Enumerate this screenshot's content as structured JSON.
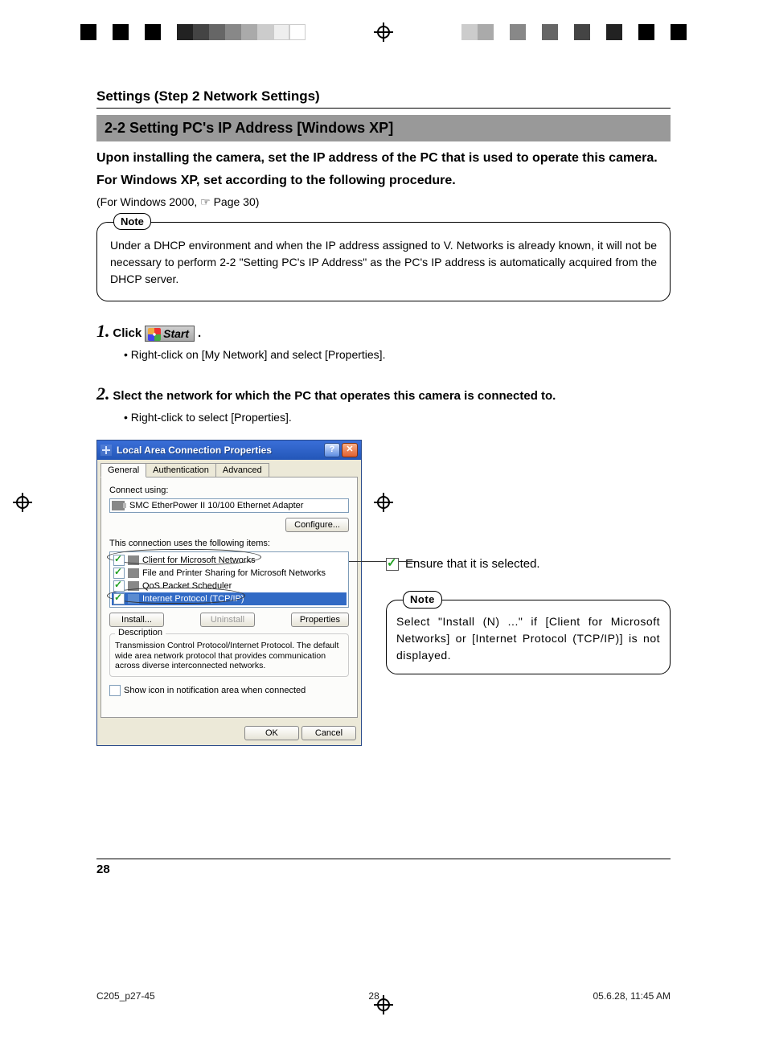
{
  "header": {
    "section_title": "Settings (Step 2 Network Settings)",
    "subsection_title": "2-2 Setting PC's IP Address [Windows XP]"
  },
  "intro": {
    "p1": "Upon installing the camera, set the IP address of the PC that is used to operate this camera.",
    "p2": "For Windows XP, set according to the following procedure.",
    "ref": "(For Windows 2000, ☞ Page 30)"
  },
  "note1": {
    "label": "Note",
    "text": "Under a DHCP environment and when the IP address assigned to V. Networks is already known, it will not be necessary to perform 2-2 \"Setting PC's IP Address\" as the PC's IP address is automatically acquired from the DHCP server."
  },
  "step1": {
    "num": "1.",
    "text_pre": "Click",
    "start_label": "Start",
    "text_post": ".",
    "bullet": "• Right-click on [My Network] and select [Properties]."
  },
  "step2": {
    "num": "2.",
    "text": "Slect the network for which the PC that operates this camera is connected to.",
    "bullet": "• Right-click to select [Properties]."
  },
  "dialog": {
    "title": "Local Area Connection Properties",
    "help": "?",
    "close": "✕",
    "tabs": {
      "general": "General",
      "auth": "Authentication",
      "adv": "Advanced"
    },
    "connect_using_label": "Connect using:",
    "adapter": "SMC EtherPower II 10/100 Ethernet Adapter",
    "configure": "Configure...",
    "items_label": "This connection uses the following items:",
    "items": {
      "i0": "Client for Microsoft Networks",
      "i1": "File and Printer Sharing for Microsoft Networks",
      "i2": "QoS Packet Scheduler",
      "i3": "Internet Protocol (TCP/IP)"
    },
    "install": "Install...",
    "uninstall": "Uninstall",
    "properties": "Properties",
    "desc_label": "Description",
    "desc_text": "Transmission Control Protocol/Internet Protocol. The default wide area network protocol that provides communication across diverse interconnected networks.",
    "show_icon": "Show icon in notification area when connected",
    "ok": "OK",
    "cancel": "Cancel"
  },
  "right": {
    "ensure": "Ensure that it is selected.",
    "note_label": "Note",
    "note_text": "Select \"Install (N) ...\" if [Client for Microsoft Networks] or [Internet Protocol (TCP/IP)] is not displayed."
  },
  "footer": {
    "page_num": "28",
    "file": "C205_p27-45",
    "slug_page": "28",
    "timestamp": "05.6.28, 11:45 AM"
  }
}
